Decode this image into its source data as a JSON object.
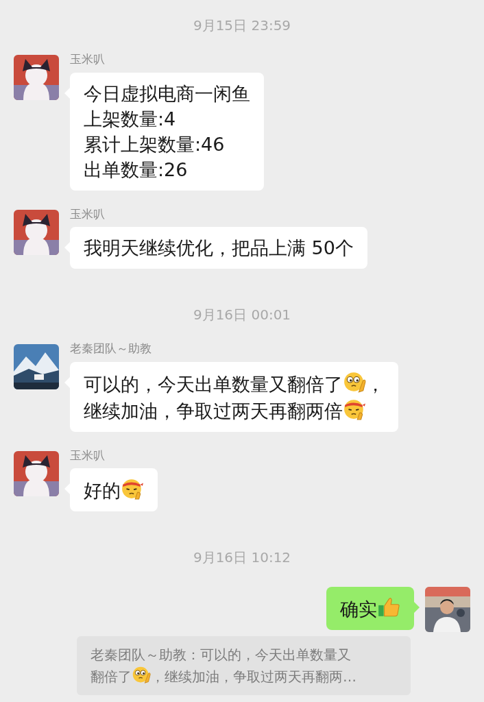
{
  "chat": [
    {
      "kind": "time",
      "text": "9月15日 23:59"
    },
    {
      "kind": "incoming",
      "avatar": {
        "kind": "cartoon"
      },
      "sender": "玉米叭",
      "lines": [
        [
          {
            "kind": "text",
            "text": "今日虚拟电商一闲鱼"
          }
        ],
        [
          {
            "kind": "text",
            "text": "上架数量:4"
          }
        ],
        [
          {
            "kind": "text",
            "text": "累计上架数量:46"
          }
        ],
        [
          {
            "kind": "text",
            "text": "出单数量:26"
          }
        ]
      ]
    },
    {
      "kind": "incoming",
      "avatar": {
        "kind": "cartoon"
      },
      "sender": "玉米叭",
      "lines": [
        [
          {
            "kind": "text",
            "text": "我明天继续优化，把品上满 50个"
          }
        ]
      ]
    },
    {
      "kind": "time",
      "text": "9月16日 00:01"
    },
    {
      "kind": "incoming",
      "avatar": {
        "kind": "landscape"
      },
      "sender": "老秦团队～助教",
      "lines": [
        [
          {
            "kind": "text",
            "text": "可以的，今天出单数量又翻倍了"
          },
          {
            "kind": "thinking"
          },
          {
            "kind": "text",
            "text": "，"
          }
        ],
        [
          {
            "kind": "text",
            "text": "继续加油，争取过两天再翻两倍"
          },
          {
            "kind": "headband"
          }
        ]
      ]
    },
    {
      "kind": "incoming",
      "avatar": {
        "kind": "cartoon"
      },
      "sender": "玉米叭",
      "lines": [
        [
          {
            "kind": "text",
            "text": "好的"
          },
          {
            "kind": "headband"
          }
        ]
      ]
    },
    {
      "kind": "time",
      "text": "9月16日 10:12"
    },
    {
      "kind": "outgoing",
      "avatar": {
        "kind": "person"
      },
      "lines": [
        [
          {
            "kind": "text",
            "text": "确实"
          },
          {
            "kind": "thumbs-up"
          }
        ]
      ]
    },
    {
      "kind": "quote",
      "lines": [
        [
          {
            "kind": "text",
            "text": "老秦团队～助教：可以的，今天出单数量又"
          }
        ],
        [
          {
            "kind": "text",
            "text": "翻倍了"
          },
          {
            "kind": "thinking"
          },
          {
            "kind": "text",
            "text": "，继续加油，争取过两天再翻两…"
          }
        ]
      ]
    }
  ]
}
